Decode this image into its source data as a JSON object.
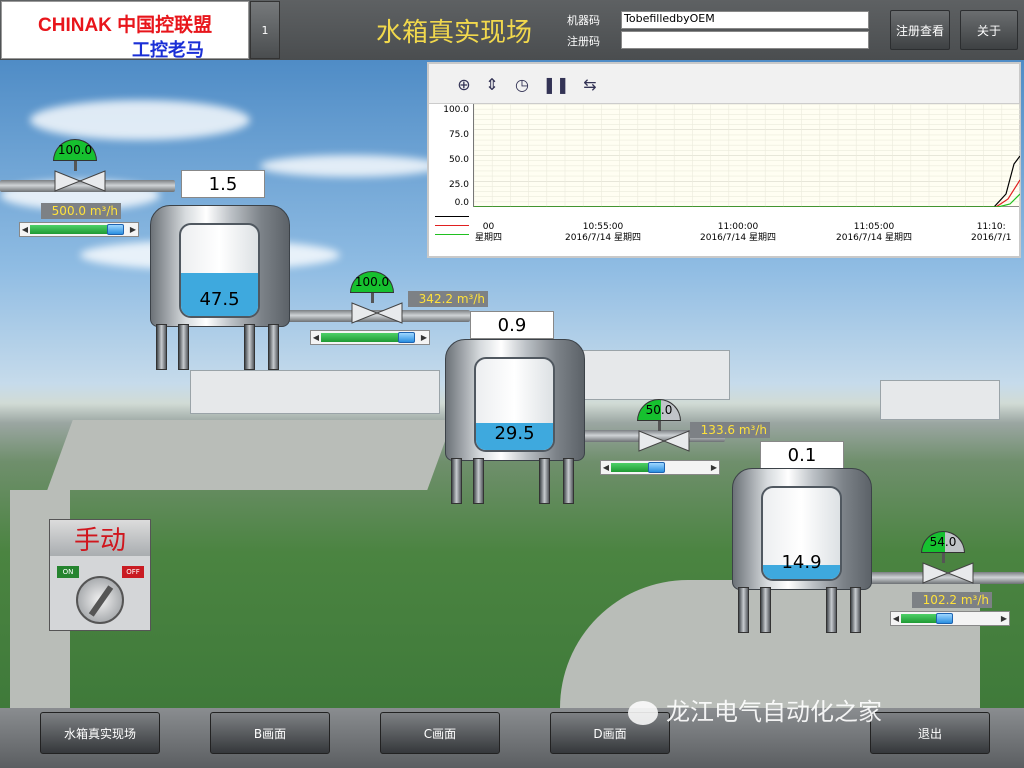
{
  "header": {
    "logo_line1": "CHINAK 中国控联盟",
    "logo_line2": "工控老马",
    "page_number": "1",
    "title": "水箱真实现场",
    "machine_code_label": "机器码",
    "machine_code_value": "TobefilledbyOEM",
    "reg_code_label": "注册码",
    "reg_code_value": "",
    "register_button": "注册查看",
    "about_button": "关于"
  },
  "tanks": [
    {
      "label": "1.5",
      "level": "47.5",
      "fill_percent": 47.5
    },
    {
      "label": "0.9",
      "level": "29.5",
      "fill_percent": 29.5
    },
    {
      "label": "0.1",
      "level": "14.9",
      "fill_percent": 14.9
    }
  ],
  "valves": [
    {
      "opening": "100.0",
      "flow": "500.0 m³/h",
      "slider_fraction": 0.88
    },
    {
      "opening": "100.0",
      "flow": "342.2 m³/h",
      "slider_fraction": 0.88
    },
    {
      "opening": "50.0",
      "flow": "133.6 m³/h",
      "slider_fraction": 0.47
    },
    {
      "opening": "54.0",
      "flow": "102.2 m³/h",
      "slider_fraction": 0.45
    }
  ],
  "trend": {
    "y_ticks": [
      "100.0",
      "75.0",
      "50.0",
      "25.0",
      "0.0"
    ],
    "x_labels": [
      {
        "time": "00",
        "date": "星期四"
      },
      {
        "time": "10:55:00",
        "date": "2016/7/14 星期四"
      },
      {
        "time": "11:00:00",
        "date": "2016/7/14 星期四"
      },
      {
        "time": "11:05:00",
        "date": "2016/7/14 星期四"
      },
      {
        "time": "11:10:",
        "date": "2016/7/1"
      }
    ],
    "series_colors": [
      "#000000",
      "#e02020",
      "#20c020"
    ],
    "toolbar_icons": [
      "zoom-icon",
      "scale-icon",
      "clock-icon",
      "pause-icon",
      "arrows-icon"
    ]
  },
  "manual_panel": {
    "title": "手动",
    "on_label": "ON",
    "off_label": "OFF"
  },
  "nav": {
    "scene_button": "水箱真实现场",
    "b_button": "B画面",
    "c_button": "C画面",
    "d_button": "D画面",
    "exit_button": "退出"
  },
  "watermark": "龙江电气自动化之家",
  "colors": {
    "accent_yellow": "#f1d84c",
    "fill_blue": "#3ea9de",
    "valve_green": "#16c12f"
  }
}
